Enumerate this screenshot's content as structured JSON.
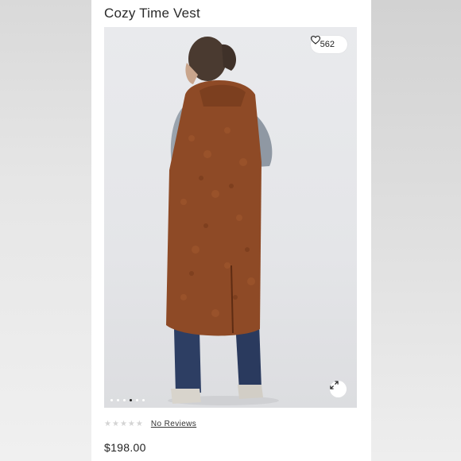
{
  "product": {
    "title": "Cozy Time Vest",
    "like_count": "562",
    "rating": 0,
    "reviews_label": "No Reviews",
    "price": "$198.00"
  },
  "gallery": {
    "total_images": 6,
    "active_index": 3
  },
  "colors": {
    "vest": "#8e4a26",
    "shirt": "#9aa3ad",
    "jeans": "#2d3e63",
    "star_empty": "#d4d4d4"
  },
  "icons": {
    "like": "heart-icon",
    "expand": "expand-icon",
    "star": "star-icon"
  }
}
